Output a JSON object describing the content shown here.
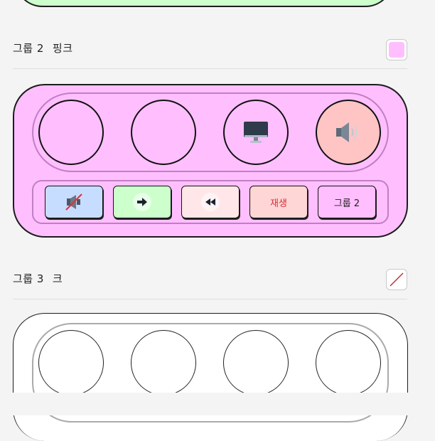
{
  "colors": {
    "page_bg": "#f4f4f4",
    "group2_bg": "#ffbfff",
    "group2_border": "#1c1c1c",
    "inner_border": "#c27ec2",
    "prev_group_bg": "#ccffcc",
    "speaker_pad_bg": "#ffc4c4",
    "mute_btn_bg": "#c7ddff",
    "next_btn_bg": "#ccffcc",
    "rewind_btn_bg": "#ffe6e8",
    "play_btn_bg": "#ffd6d6",
    "play_text": "#d6303a",
    "group3_border": "#aaaaaa"
  },
  "group2": {
    "title": "그룹 2",
    "color_name": "핑크",
    "swatch_color": "#ffbfff",
    "pads": [
      {
        "icon": "empty"
      },
      {
        "icon": "empty"
      },
      {
        "icon": "monitor-icon"
      },
      {
        "icon": "speaker-icon"
      }
    ],
    "controls": {
      "mute_icon": "mute-icon",
      "next_icon": "arrow-right-icon",
      "rewind_icon": "rewind-icon",
      "play_label": "재생",
      "group_label": "그룹 2"
    }
  },
  "group3": {
    "title": "그룹 3",
    "color_name": "크",
    "swatch_color": "none"
  }
}
